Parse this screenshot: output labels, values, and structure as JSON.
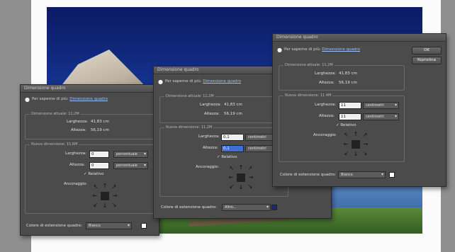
{
  "dialogs": {
    "left": {
      "title": "Dimensione quadro",
      "tip_text": "Per saperne di più:",
      "tip_link": "Dimensione quadro",
      "current_legend": "Dimensione attuale: 11,2M",
      "width_label": "Larghezza:",
      "width_value": "41,83 cm",
      "height_label": "Altezza:",
      "height_value": "56,19 cm",
      "new_legend": "Nuova dimensione: 15,6M",
      "new_width_label": "Larghezza:",
      "new_width_value": "0",
      "new_width_unit": "percentuale",
      "new_height_label": "Altezza:",
      "new_height_value": "0",
      "new_height_unit": "percentuale",
      "relative_label": "Relativo",
      "anchor_label": "Ancoraggio:",
      "ext_color_label": "Colore di estensione quadro:",
      "ext_color_value": "Bianco"
    },
    "middle": {
      "title": "Dimensione quadro",
      "tip_text": "Per saperne di più:",
      "tip_link": "Dimensione quadro",
      "current_legend": "Dimensione attuale: 11,2M",
      "width_label": "Larghezza:",
      "width_value": "41,83 cm",
      "height_label": "Altezza:",
      "height_value": "56,19 cm",
      "new_legend": "Nuova dimensione: 11,2M",
      "new_width_label": "Larghezza:",
      "new_width_value": "0,1",
      "new_width_unit": "centimetri",
      "new_height_label": "Altezza:",
      "new_height_value": "0,1",
      "new_height_unit": "centimetri",
      "relative_label": "Relativo",
      "anchor_label": "Ancoraggio:",
      "ext_color_label": "Colore di estensione quadro:",
      "ext_color_value": "Altro..."
    },
    "right": {
      "title": "Dimensione quadro",
      "tip_text": "Per saperne di più:",
      "tip_link": "Dimensione quadro",
      "current_legend": "Dimensione attuale: 11,2M",
      "width_label": "Larghezza:",
      "width_value": "41,83 cm",
      "height_label": "Altezza:",
      "height_value": "56,19 cm",
      "new_legend": "Nuova dimensione: 11,4M",
      "new_width_label": "Larghezza:",
      "new_width_value": "11",
      "new_width_unit": "centimetri",
      "new_height_label": "Altezza:",
      "new_height_value": "11",
      "new_height_unit": "centimetri",
      "relative_label": "Relativo",
      "anchor_label": "Ancoraggio:",
      "ext_color_label": "Colore di estensione quadro:",
      "ext_color_value": "Bianco",
      "ok_label": "OK",
      "cancel_label": "Ripristina"
    }
  },
  "icons": {
    "tip": "lightbulb-icon",
    "anchor_center": "anchor-center-square",
    "anchor_arrows": "anchor-arrow-icon"
  },
  "colors": {
    "dialog_bg": "#4b4b4b",
    "sky": "#173a9c",
    "selected_field": "#3d6fd8",
    "white_swatch": "#ffffff",
    "dark_swatch": "#1d2a66"
  }
}
